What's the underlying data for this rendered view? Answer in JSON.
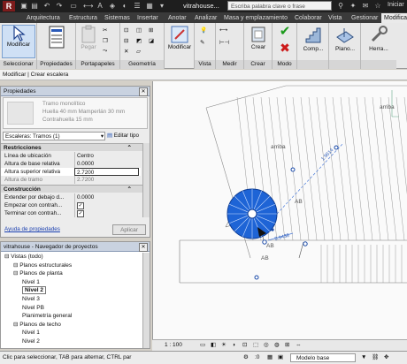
{
  "quick_access": {
    "title": "vitrahouse...",
    "search_placeholder": "Escriba palabra clave o frase",
    "user_label": "Iniciar"
  },
  "tabs": [
    "Arquitectura",
    "Estructura",
    "Sistemas",
    "Insertar",
    "Anotar",
    "Analizar",
    "Masa y emplazamiento",
    "Colaborar",
    "Vista",
    "Gestionar",
    "Modificar"
  ],
  "ribbon": {
    "modificar_label": "Modificar",
    "pegar_label": "Pegar",
    "modificar2_label": "Modificar",
    "crear_label": "Crear",
    "comp_label": "Comp...",
    "plano_label": "Plano...",
    "herra_label": "Herra...",
    "groups": [
      "Seleccionar",
      "Propiedades",
      "Portapapeles",
      "Geometría",
      "Vista",
      "Medir",
      "Crear",
      "Modo"
    ]
  },
  "mode_bar": "Modificar | Crear escalera",
  "properties": {
    "title": "Propiedades",
    "type_lines": [
      "Tramo monolítico",
      "Huella 40 mm Mamperlán 30 mm",
      "Contrahuella 15 mm"
    ],
    "filter_value": "Escaleras: Tramos (1)",
    "edit_type": "Editar tipo",
    "sections": [
      {
        "name": "Restricciones",
        "rows": [
          {
            "k": "Línea de ubicación",
            "v": "Centro"
          },
          {
            "k": "Altura de base relativa",
            "v": "0.0000"
          },
          {
            "k": "Altura superior relativa",
            "v": "2.7200"
          },
          {
            "k": "Altura de tramo",
            "v": "2.7200"
          }
        ]
      },
      {
        "name": "Construcción",
        "rows": [
          {
            "k": "Extender por debajo d...",
            "v": "0.0000"
          },
          {
            "k": "Empezar con contrah...",
            "v": ""
          },
          {
            "k": "Terminar con contrah...",
            "v": ""
          }
        ]
      }
    ],
    "help_link": "Ayuda de propiedades",
    "apply": "Aplicar"
  },
  "browser": {
    "title": "vitrahouse - Navegador de proyectos",
    "items": [
      {
        "t": "Vistas (todo)",
        "l": 0
      },
      {
        "t": "Planos estructurales",
        "l": 1
      },
      {
        "t": "Planos de planta",
        "l": 1
      },
      {
        "t": "Nivel 1",
        "l": 2
      },
      {
        "t": "Nivel 2",
        "l": 2,
        "bold": true
      },
      {
        "t": "Nivel 3",
        "l": 2
      },
      {
        "t": "Nivel PB",
        "l": 2
      },
      {
        "t": "Planimetría general",
        "l": 2
      },
      {
        "t": "Planos de techo",
        "l": 1
      },
      {
        "t": "Nivel 1",
        "l": 2
      },
      {
        "t": "Nivel 2",
        "l": 2
      }
    ]
  },
  "canvas": {
    "labels": [
      "arriba",
      "arriba",
      "AB",
      "AB",
      "AB"
    ],
    "dims": [
      "1.9614",
      "0.9438"
    ]
  },
  "view_bar": {
    "scale": "1 : 100"
  },
  "status": {
    "text": "Clic para seleccionar, TAB para alternar, CTRL par",
    "zoom": ":0",
    "model": "Modelo base"
  }
}
